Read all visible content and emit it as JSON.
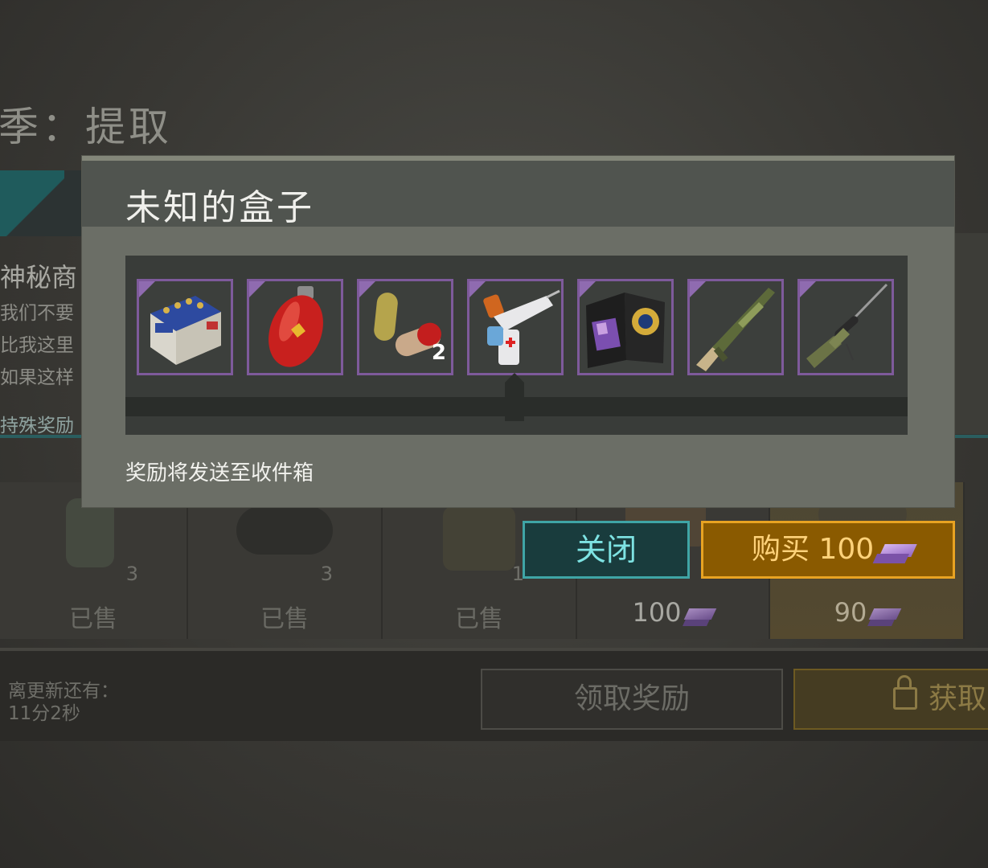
{
  "background": {
    "season_title": "季：提取",
    "shop_title": "神秘商",
    "shop_lines": [
      "我们不要",
      "比我这里",
      "如果这样"
    ],
    "special_label": "持殊奖励",
    "cells": [
      {
        "count": "3",
        "label": "已售"
      },
      {
        "count": "3",
        "label": "已售"
      },
      {
        "count": "1",
        "label": "已售"
      },
      {
        "price": "100",
        "currency_icon": "purple-bar-icon"
      },
      {
        "price": "90",
        "currency_icon": "purple-bar-icon"
      }
    ],
    "refresh_label_line1": "离更新还有：",
    "refresh_time": "11分2秒",
    "claim_button": "领取奖励",
    "get_button": "获取"
  },
  "dialog": {
    "title": "未知的盒子",
    "items": [
      {
        "name": "battery",
        "qty": ""
      },
      {
        "name": "gas-canister",
        "qty": ""
      },
      {
        "name": "pills",
        "qty": "2"
      },
      {
        "name": "injector-gun",
        "qty": ""
      },
      {
        "name": "police-badge",
        "qty": ""
      },
      {
        "name": "shotgun",
        "qty": ""
      },
      {
        "name": "sniper-rifle",
        "qty": ""
      }
    ],
    "reward_note": "奖励将发送至收件箱",
    "close_button": "关闭",
    "buy_button": "购买 100",
    "colors": {
      "close_accent": "#3fa5a6",
      "buy_accent": "#e8a322",
      "rarity_border": "#7e5a9b"
    }
  }
}
